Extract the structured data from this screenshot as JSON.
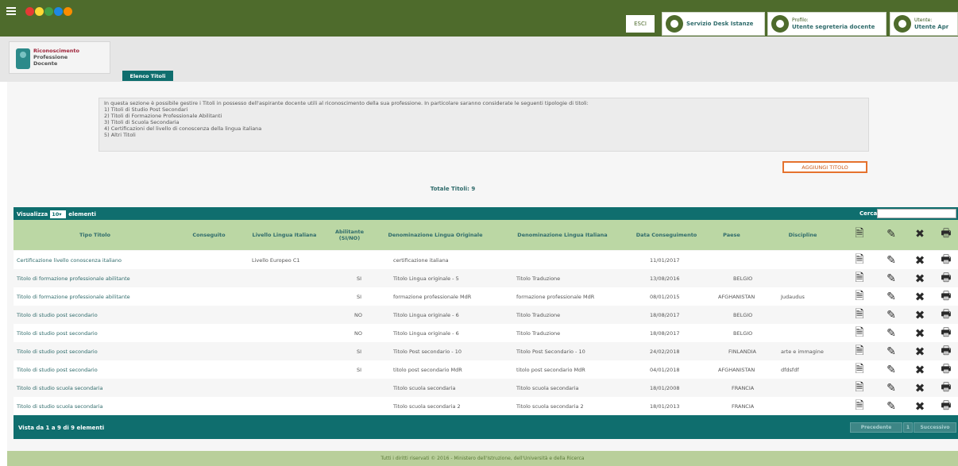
{
  "topbar": {
    "logout_label": "ESCI",
    "help_title": "Servizio Desk Istanze",
    "profile_label": "Profilo:",
    "profile_value": "Utente segreteria docente",
    "user_label": "Utente:",
    "user_value": "Utente Apr"
  },
  "brand": {
    "line1": "Riconoscimento",
    "line2": "Professione",
    "line3": "Docente"
  },
  "tab_label": "Elenco Titoli",
  "info": {
    "lines": [
      "In questa sezione è possibile gestire i Titoli in possesso dell'aspirante docente utili al riconoscimento della sua professione. In particolare saranno considerate le seguenti tipologie di titoli:",
      "1) Titoli di Studio Post Secondari",
      "2) Titoli di Formazione Professionale Abilitanti",
      "3) Titoli di Scuola Secondaria",
      "4) Certificazioni del livello di conoscenza della lingua italiana",
      "5) Altri Titoli"
    ]
  },
  "add_button": "AGGIUNGI TITOLO",
  "totale": "Totale Titoli: 9",
  "table": {
    "show_label": "Visualizza",
    "page_size": "10",
    "entries_label": "elementi",
    "search_label": "Cerca:",
    "search_value": "",
    "headers": [
      "Tipo Titolo",
      "Conseguito",
      "Livello Lingua Italiana",
      "Abilitante (SI/NO)",
      "Denominazione Lingua Originale",
      "Denominazione Lingua Italiana",
      "Data Conseguimento",
      "Paese",
      "Discipline"
    ],
    "rows": [
      [
        "Certificazione livello conoscenza italiano",
        "",
        "Livello Europeo C1",
        "",
        "certificazione italiana",
        "",
        "11/01/2017",
        "",
        ""
      ],
      [
        "Titolo di formazione professionale abilitante",
        "",
        "",
        "SI",
        "Titolo Lingua originale - 5",
        "Titolo Traduzione",
        "13/08/2016",
        "BELGIO",
        ""
      ],
      [
        "Titolo di formazione professionale abilitante",
        "",
        "",
        "SI",
        "formazione professionale MdR",
        "formazione professionale MdR",
        "08/01/2015",
        "AFGHANISTAN",
        "Judaudus"
      ],
      [
        "Titolo di studio post secondario",
        "",
        "",
        "NO",
        "Titolo Lingua originale - 6",
        "Titolo Traduzione",
        "18/08/2017",
        "BELGIO",
        ""
      ],
      [
        "Titolo di studio post secondario",
        "",
        "",
        "NO",
        "Titolo Lingua originale - 6",
        "Titolo Traduzione",
        "18/08/2017",
        "BELGIO",
        ""
      ],
      [
        "Titolo di studio post secondario",
        "",
        "",
        "SI",
        "Titolo Post secondario - 10",
        "Titolo Post Secondario - 10",
        "24/02/2018",
        "FINLANDIA",
        "arte e immagine"
      ],
      [
        "Titolo di studio post secondario",
        "",
        "",
        "SI",
        "titolo post secondario MdR",
        "titolo post secondario MdR",
        "04/01/2018",
        "AFGHANISTAN",
        "dfdsfdf"
      ],
      [
        "Titolo di studio scuola secondaria",
        "",
        "",
        "",
        "Titolo scuola secondaria",
        "Titolo scuola secondaria",
        "18/01/2008",
        "FRANCIA",
        ""
      ],
      [
        "Titolo di studio scuola secondaria",
        "",
        "",
        "",
        "Titolo scuola secondaria 2",
        "Titolo scuola secondaria 2",
        "18/01/2013",
        "FRANCIA",
        ""
      ]
    ],
    "footer_info": "Vista da 1 a 9 di 9 elementi",
    "prev_label": "Precedente",
    "page_label": "1",
    "next_label": "Successivo"
  },
  "footer_text": "Tutti i diritti riservati © 2016 - Ministero dell'Istruzione, dell'Università e della Ricerca",
  "colors": {
    "topbar": "#4e6b2c",
    "teal": "#0f6e6e",
    "header_row": "#bbd7a4",
    "accent_orange": "#e5722e"
  },
  "icons": [
    "menu-icon",
    "help-desk-icon",
    "profile-icon",
    "user-icon",
    "document-icon",
    "edit-icon",
    "delete-icon",
    "print-icon"
  ]
}
